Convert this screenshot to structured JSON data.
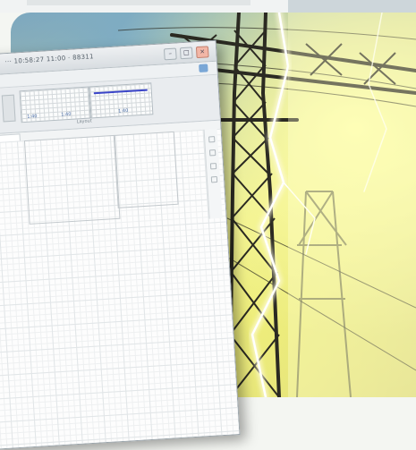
{
  "window": {
    "title": "··· 10:58:27 11:00 · 88311",
    "controls": [
      "–",
      "□",
      "×"
    ]
  },
  "ribbon": {
    "preview_captions": [
      "1:40",
      "1:40",
      "1:40"
    ],
    "group_label": "Layout"
  },
  "sheet": {
    "tab_label": ""
  },
  "colors": {
    "accent_blue": "#3b45c8",
    "sky": "#7ea6bd",
    "lightning_glow": "#f6f6a8",
    "tower": "#2b2a22"
  }
}
